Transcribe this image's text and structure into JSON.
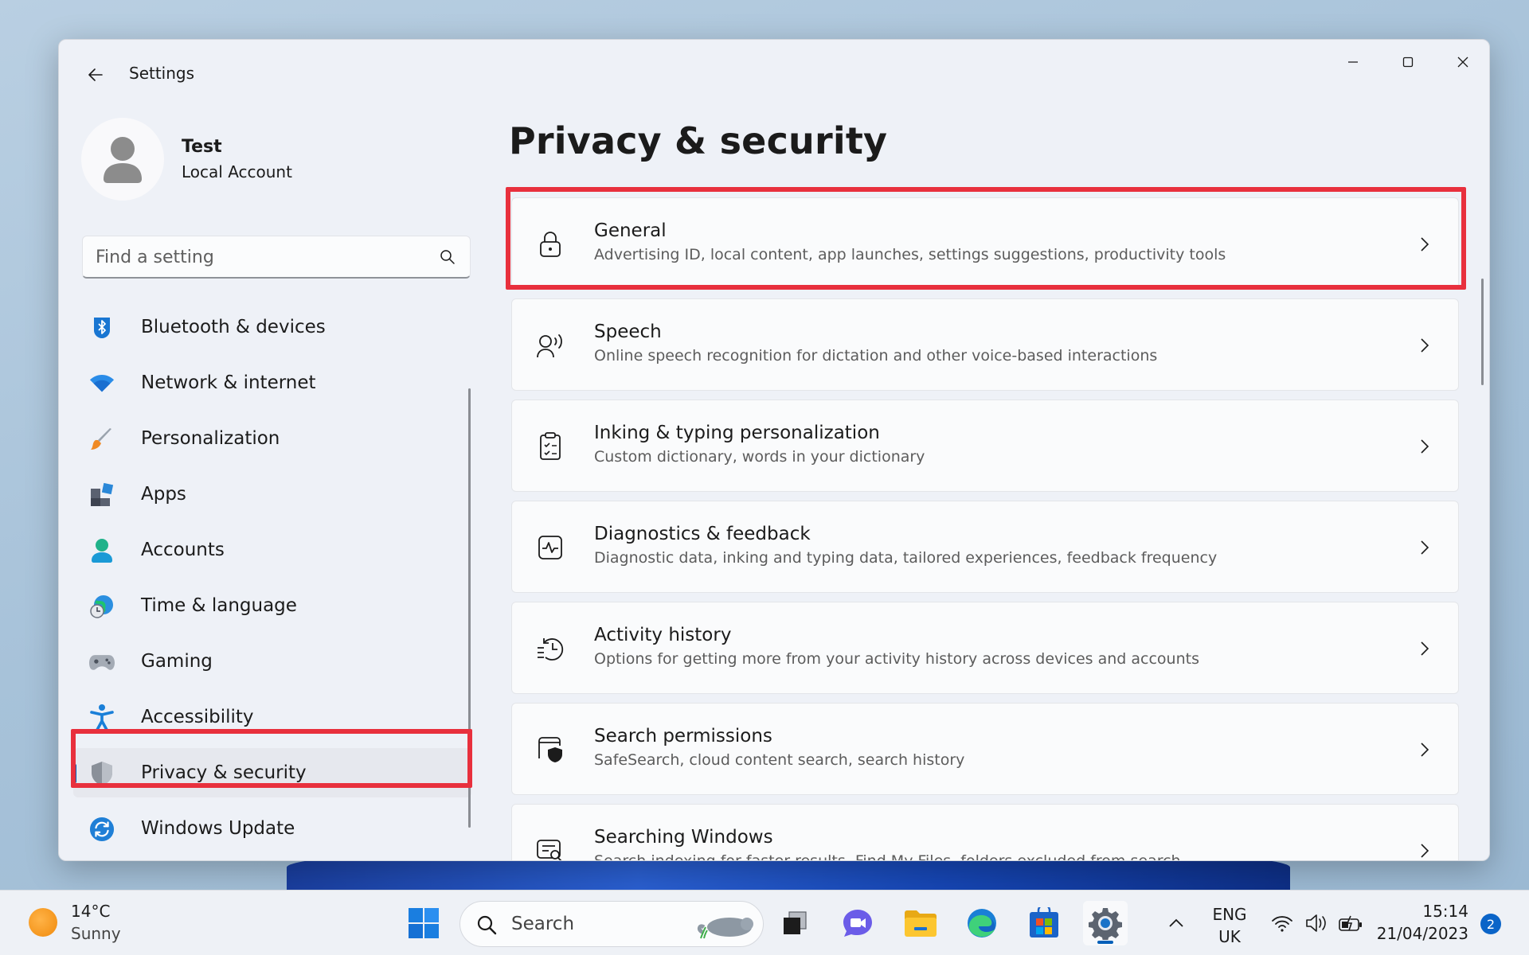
{
  "window": {
    "title": "Settings",
    "controls": {
      "minimize": "—",
      "maximize": "☐",
      "close": "✕"
    }
  },
  "profile": {
    "name": "Test",
    "account_type": "Local Account"
  },
  "search": {
    "placeholder": "Find a setting",
    "value": ""
  },
  "sidebar": {
    "items": [
      {
        "label": "Bluetooth & devices",
        "icon": "bluetooth-icon"
      },
      {
        "label": "Network & internet",
        "icon": "wifi-icon"
      },
      {
        "label": "Personalization",
        "icon": "brush-icon"
      },
      {
        "label": "Apps",
        "icon": "apps-icon"
      },
      {
        "label": "Accounts",
        "icon": "accounts-icon"
      },
      {
        "label": "Time & language",
        "icon": "globe-clock-icon"
      },
      {
        "label": "Gaming",
        "icon": "gamepad-icon"
      },
      {
        "label": "Accessibility",
        "icon": "accessibility-icon"
      },
      {
        "label": "Privacy & security",
        "icon": "shield-icon",
        "selected": true
      },
      {
        "label": "Windows Update",
        "icon": "update-icon"
      }
    ]
  },
  "main": {
    "title": "Privacy & security",
    "cards": [
      {
        "title": "General",
        "desc": "Advertising ID, local content, app launches, settings suggestions, productivity tools",
        "icon": "lock-icon"
      },
      {
        "title": "Speech",
        "desc": "Online speech recognition for dictation and other voice-based interactions",
        "icon": "speech-icon"
      },
      {
        "title": "Inking & typing personalization",
        "desc": "Custom dictionary, words in your dictionary",
        "icon": "clipboard-icon"
      },
      {
        "title": "Diagnostics & feedback",
        "desc": "Diagnostic data, inking and typing data, tailored experiences, feedback frequency",
        "icon": "diagnostics-icon"
      },
      {
        "title": "Activity history",
        "desc": "Options for getting more from your activity history across devices and accounts",
        "icon": "history-icon"
      },
      {
        "title": "Search permissions",
        "desc": "SafeSearch, cloud content search, search history",
        "icon": "search-shield-icon"
      },
      {
        "title": "Searching Windows",
        "desc": "Search indexing for faster results, Find My Files, folders excluded from search",
        "icon": "search-windows-icon"
      }
    ]
  },
  "taskbar": {
    "weather": {
      "temp": "14°C",
      "condition": "Sunny"
    },
    "search_label": "Search",
    "language": {
      "line1": "ENG",
      "line2": "UK"
    },
    "clock": {
      "time": "15:14",
      "date": "21/04/2023"
    },
    "notifications": "2"
  },
  "colors": {
    "accent": "#005fb8",
    "highlight": "#e8303d"
  }
}
